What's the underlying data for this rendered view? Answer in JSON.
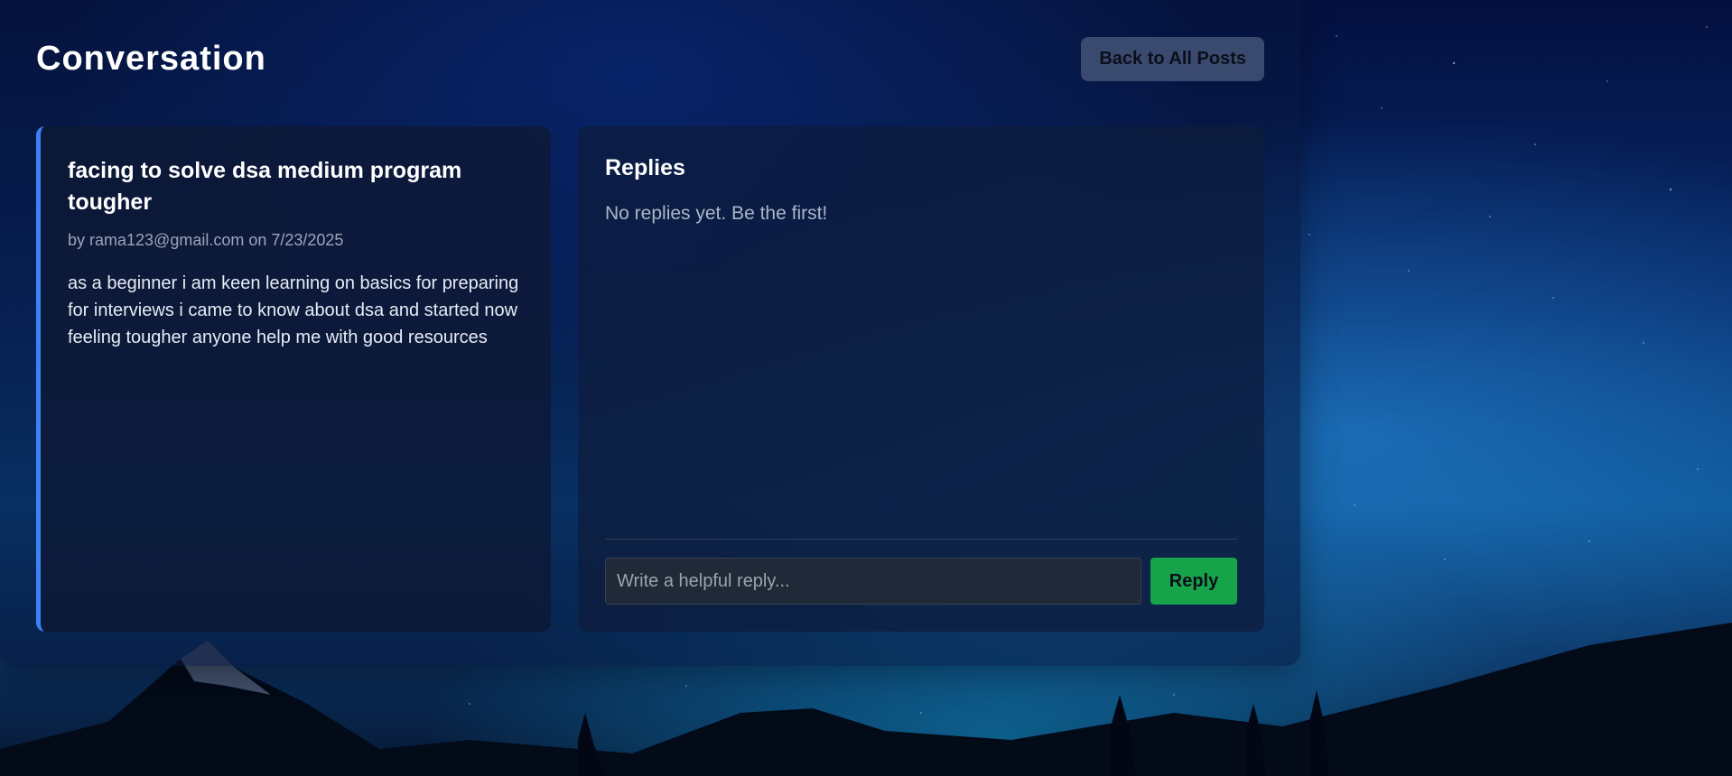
{
  "header": {
    "title": "Conversation",
    "back_label": "Back to All Posts"
  },
  "post": {
    "title": "facing to solve dsa medium program tougher",
    "meta": "by rama123@gmail.com on 7/23/2025",
    "body": "as a beginner i am keen learning on basics for preparing for interviews i came to know about dsa and started now feeling tougher anyone help me with good resources"
  },
  "replies": {
    "title": "Replies",
    "empty_text": "No replies yet. Be the first!",
    "input_placeholder": "Write a helpful reply...",
    "input_value": "",
    "reply_label": "Reply"
  },
  "colors": {
    "accent": "#3b82f6",
    "reply_button": "#16a34a",
    "back_button": "#3a4a6e"
  }
}
